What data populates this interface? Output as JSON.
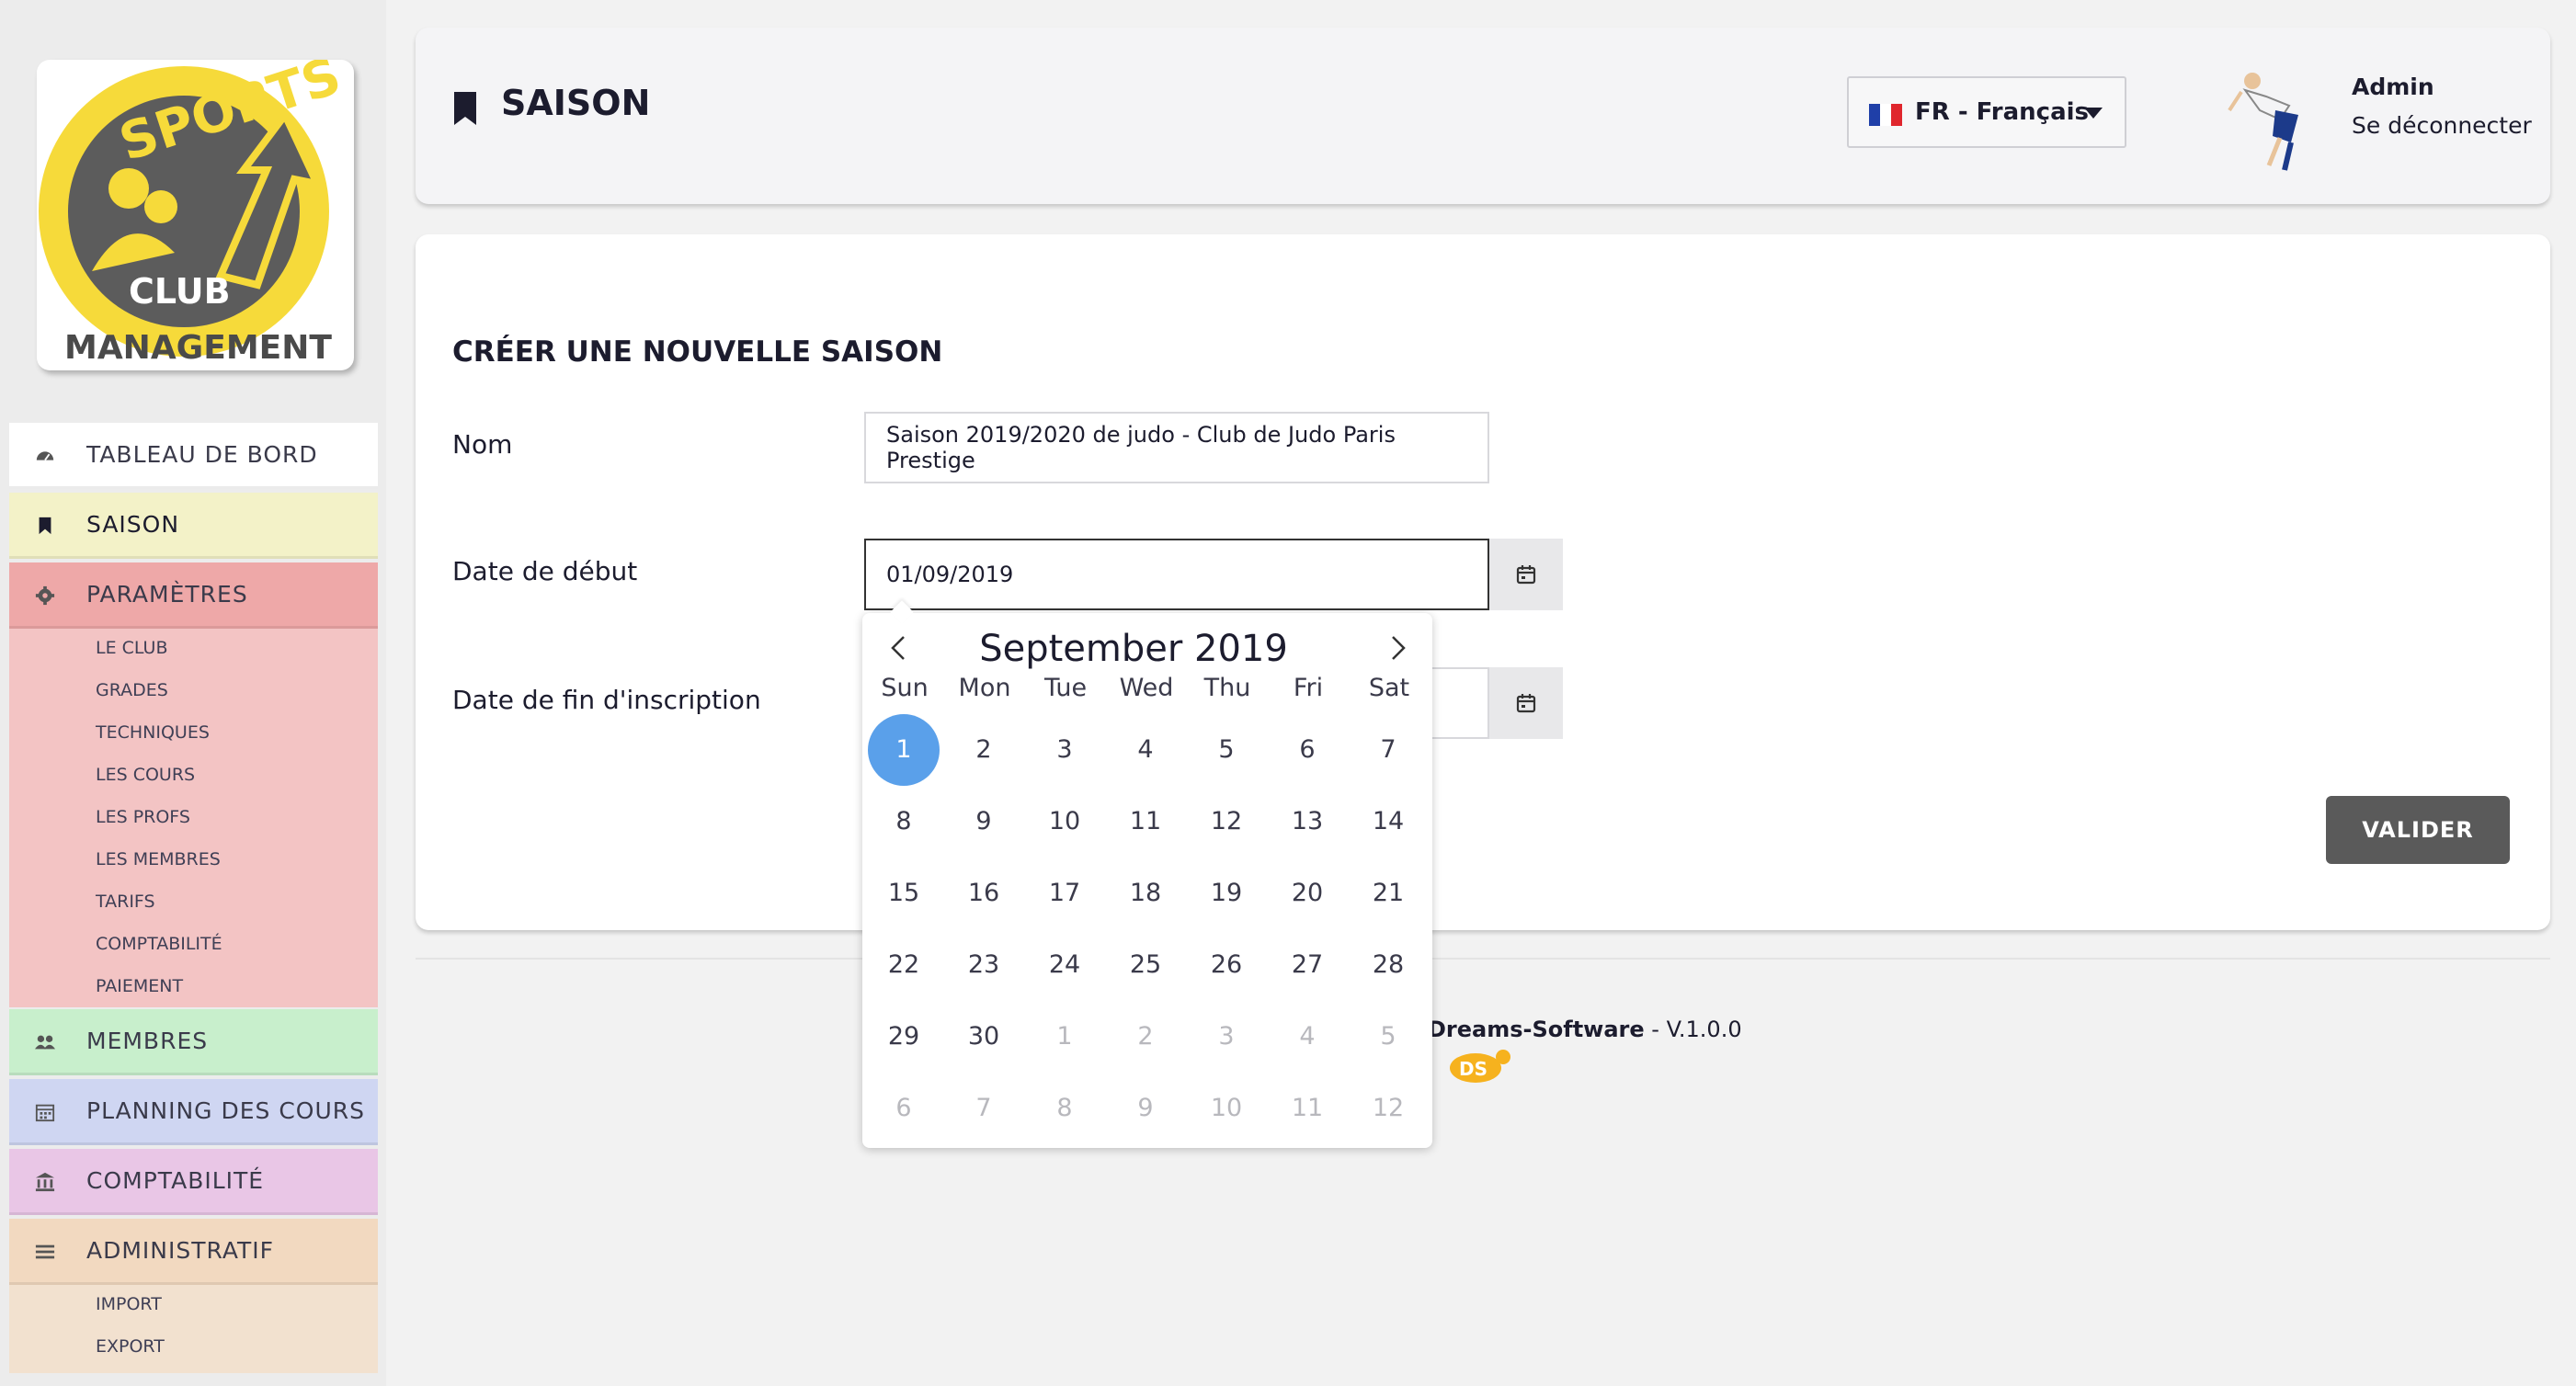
{
  "sidebar": {
    "items": [
      {
        "label": "TABLEAU DE BORD",
        "color": "#ffffff"
      },
      {
        "label": "SAISON",
        "color": "#f3f2c8"
      },
      {
        "label": "PARAMÈTRES",
        "color": "#eea8a8",
        "subitems": [
          "LE CLUB",
          "GRADES",
          "TECHNIQUES",
          "LES COURS",
          "LES PROFS",
          "LES MEMBRES",
          "TARIFS",
          "COMPTABILITÉ",
          "PAIEMENT"
        ],
        "sub_color": "#f3c4c4"
      },
      {
        "label": "MEMBRES",
        "color": "#c8efcc"
      },
      {
        "label": "PLANNING DES COURS",
        "color": "#cfd6f2"
      },
      {
        "label": "COMPTABILITÉ",
        "color": "#e9c6e6"
      },
      {
        "label": "ADMINISTRATIF",
        "color": "#f2d9c0",
        "subitems": [
          "IMPORT",
          "EXPORT"
        ],
        "sub_color": "#f2e1cf"
      }
    ]
  },
  "header": {
    "title": "SAISON",
    "language": "FR - Français",
    "user": "Admin",
    "logout": "Se déconnecter"
  },
  "form": {
    "title": "CRÉER UNE NOUVELLE SAISON",
    "nom_label": "Nom",
    "nom_value": "Saison 2019/2020 de judo - Club de Judo Paris Prestige",
    "date_debut_label": "Date de début",
    "date_debut_value": "01/09/2019",
    "date_fin_label": "Date de fin d'inscription",
    "date_fin_value": "",
    "submit": "VALIDER"
  },
  "datepicker": {
    "month": "September",
    "year": "2019",
    "weekdays": [
      "Sun",
      "Mon",
      "Tue",
      "Wed",
      "Thu",
      "Fri",
      "Sat"
    ],
    "weeks": [
      [
        "1",
        "2",
        "3",
        "4",
        "5",
        "6",
        "7"
      ],
      [
        "8",
        "9",
        "10",
        "11",
        "12",
        "13",
        "14"
      ],
      [
        "15",
        "16",
        "17",
        "18",
        "19",
        "20",
        "21"
      ],
      [
        "22",
        "23",
        "24",
        "25",
        "26",
        "27",
        "28"
      ],
      [
        "29",
        "30",
        "1",
        "2",
        "3",
        "4",
        "5"
      ],
      [
        "6",
        "7",
        "8",
        "9",
        "10",
        "11",
        "12"
      ]
    ],
    "selected": "1",
    "selected_color": "#5aa0ea"
  },
  "footer": {
    "brand": "Dreams-Software",
    "version": " - V.1.0.0"
  },
  "logo": {
    "top_text": "SPORTS",
    "mid_text": "CLUB",
    "bottom_text": "MANAGEMENT"
  }
}
